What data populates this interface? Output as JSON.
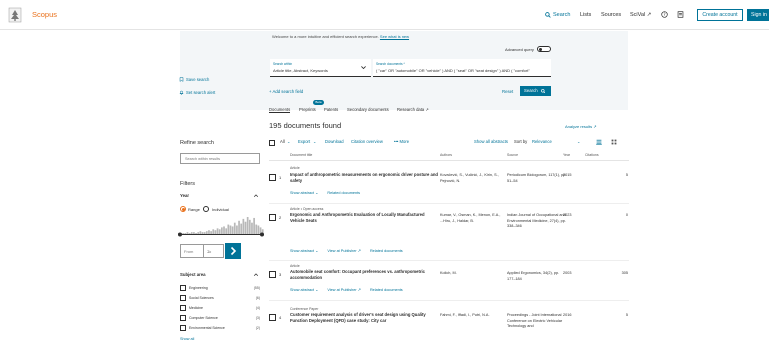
{
  "header": {
    "brand": "Scopus",
    "nav": [
      "Search",
      "Lists",
      "Sources",
      "SciVal ↗"
    ],
    "create_account": "Create account",
    "sign_in": "Sign in"
  },
  "search": {
    "welcome": "Welcome to a more intuitive and efficient search experience.",
    "welcome_link": "See what is new",
    "advanced_query": "Advanced query",
    "within_label": "Search within",
    "within_value": "Article title, Abstract, Keywords",
    "docs_label": "Search documents *",
    "docs_value": "( \"car\" OR \"automobile\" OR \"vehicle\" ) AND ( \"seat\" OR \"seat design\" ) AND ( \"comfort\"",
    "add_field": "+ Add search field",
    "reset": "Reset",
    "search_button": "Search",
    "tabs": [
      "Documents",
      "Preprints",
      "Patents",
      "Secondary documents",
      "Research data ↗"
    ],
    "beta": "Beta"
  },
  "sidebar": {
    "save_search": "Save search",
    "set_alert": "Set search alert",
    "refine_title": "Refine search",
    "refine_placeholder": "Search within results",
    "filters": "Filters",
    "year": "Year",
    "range": "Range",
    "individual": "Individual",
    "from": "From",
    "to": "To",
    "subject_area": "Subject area",
    "subjects": [
      {
        "name": "Engineering",
        "count": "(55)"
      },
      {
        "name": "Social Sciences",
        "count": "(6)"
      },
      {
        "name": "Medicine",
        "count": "(4)"
      },
      {
        "name": "Computer Science",
        "count": "(3)"
      },
      {
        "name": "Environmental Science",
        "count": "(2)"
      }
    ],
    "show_all": "Show all"
  },
  "results": {
    "count": "195 documents found",
    "analyze": "Analyze results ↗",
    "toolbar": {
      "all": "All",
      "export": "Export",
      "download": "Download",
      "citation_overview": "Citation overview",
      "more": "••• More",
      "show_all_abstracts": "Show all abstracts",
      "sort_by": "Sort by",
      "sort_value": "Relevance"
    },
    "columns": [
      "Document title",
      "Authors",
      "Source",
      "Year",
      "Citations"
    ],
    "rows": [
      {
        "num": "1",
        "type": "Article",
        "title": "Impact of anthropometric measurements on ergonomic driver posture and safety",
        "authors": "Kovačević, S., Vučinić, J., Kirin, S., Pejnović, N.",
        "source": "Periodicum Biologorum, 117(1), pp. 51–54",
        "year": "2015",
        "citations": "5",
        "actions": [
          "Show abstract ⌄",
          "Related documents"
        ]
      },
      {
        "num": "2",
        "type": "Article • Open access",
        "title": "Ergonomic and Anthropometric Evaluation of Locally Manufactured Vehicle Seats",
        "authors": "Kumar, V., Osman, K., Menon, E.A., ...Hiru, J., Haldar, B.",
        "source": "Indian Journal of Occupational and Environmental Medicine, 27(4), pp. 338–346",
        "year": "2023",
        "citations": "0",
        "actions": [
          "Show abstract ⌄",
          "View at Publisher ↗",
          "Related documents"
        ]
      },
      {
        "num": "3",
        "type": "Article",
        "title": "Automobile seat comfort: Occupant preferences vs. anthropometric accommodation",
        "authors": "Kolich, M.",
        "source": "Applied Ergonomics, 34(2), pp. 177–184",
        "year": "2003",
        "citations": "305",
        "actions": [
          "Show abstract ⌄",
          "View at Publisher ↗",
          "Related documents"
        ]
      },
      {
        "num": "4",
        "type": "Conference Paper",
        "title": "Customer requirement analysis of driver's seat design using Quality Function Deployment (QFD) case study: City car",
        "authors": "Fahmi, F., Iffadi, I., Putri, N.A.",
        "source": "Proceedings - Joint International Conference on Electric Vehicular Technology and",
        "year": "2016",
        "citations": "5",
        "actions": []
      }
    ]
  },
  "histogram": [
    1,
    1,
    1,
    1,
    2,
    1,
    2,
    2,
    1,
    2,
    3,
    2,
    2,
    3,
    4,
    3,
    5,
    4,
    6,
    5,
    7,
    8,
    6,
    10,
    9,
    8,
    12,
    9,
    14,
    11,
    16,
    13,
    18,
    15,
    12,
    17,
    10,
    9,
    7,
    5
  ]
}
